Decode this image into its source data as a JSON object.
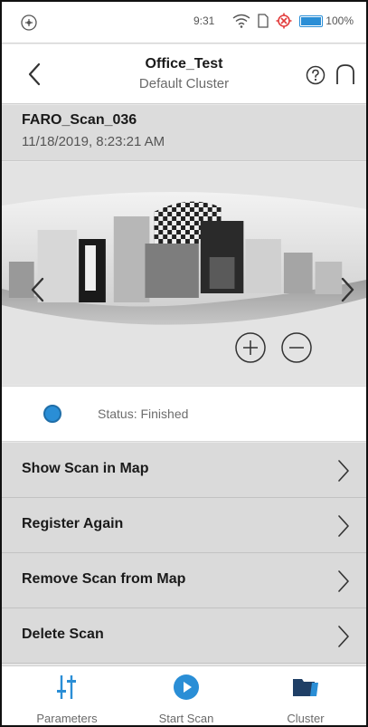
{
  "statusbar": {
    "time": "9:31",
    "battery": "100%",
    "icons": [
      "app-icon",
      "wifi-icon",
      "sim-icon",
      "location-off-icon",
      "battery-icon"
    ]
  },
  "header": {
    "title": "Office_Test",
    "subtitle": "Default Cluster",
    "icons": [
      "back-icon",
      "help-icon",
      "home-icon"
    ]
  },
  "scan": {
    "name": "FARO_Scan_036",
    "date": "11/18/2019, 8:23:21 AM"
  },
  "preview": {
    "icons": [
      "chevron-left-icon",
      "chevron-right-icon",
      "zoom-in-icon",
      "zoom-out-icon"
    ]
  },
  "status": {
    "text": "Status: Finished",
    "color": "#2a8ed6"
  },
  "actions": [
    {
      "label": "Show Scan in Map"
    },
    {
      "label": "Register Again"
    },
    {
      "label": "Remove Scan from Map"
    },
    {
      "label": "Delete Scan"
    }
  ],
  "bottom_nav": [
    {
      "label": "Parameters",
      "icon": "sliders-icon"
    },
    {
      "label": "Start Scan",
      "icon": "play-icon"
    },
    {
      "label": "Cluster",
      "icon": "folder-icon"
    }
  ],
  "colors": {
    "accent": "#2a8ed6"
  }
}
